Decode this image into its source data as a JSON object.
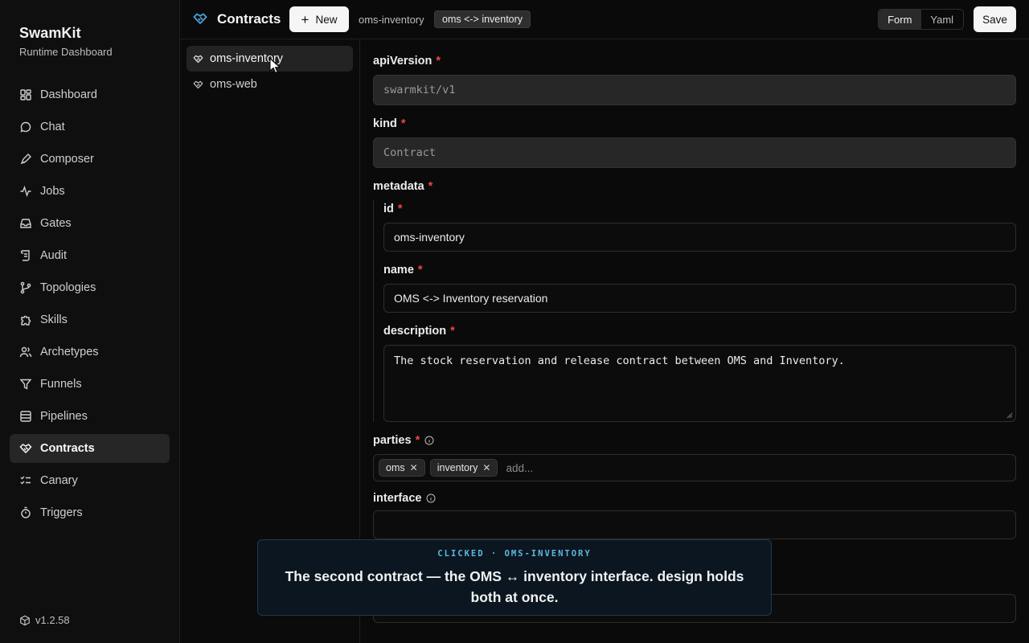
{
  "brand": {
    "name": "SwamKit",
    "subtitle": "Runtime Dashboard"
  },
  "nav": [
    {
      "label": "Dashboard",
      "icon": "dashboard-icon"
    },
    {
      "label": "Chat",
      "icon": "chat-icon"
    },
    {
      "label": "Composer",
      "icon": "composer-icon"
    },
    {
      "label": "Jobs",
      "icon": "activity-icon"
    },
    {
      "label": "Gates",
      "icon": "inbox-icon"
    },
    {
      "label": "Audit",
      "icon": "scroll-icon"
    },
    {
      "label": "Topologies",
      "icon": "branch-icon"
    },
    {
      "label": "Skills",
      "icon": "puzzle-icon"
    },
    {
      "label": "Archetypes",
      "icon": "users-icon"
    },
    {
      "label": "Funnels",
      "icon": "funnel-icon"
    },
    {
      "label": "Pipelines",
      "icon": "rows-icon"
    },
    {
      "label": "Contracts",
      "icon": "handshake-icon",
      "active": true
    },
    {
      "label": "Canary",
      "icon": "checklist-icon"
    },
    {
      "label": "Triggers",
      "icon": "timer-icon"
    }
  ],
  "version": "v1.2.58",
  "header": {
    "title": "Contracts",
    "new_label": "New",
    "breadcrumb": "oms-inventory",
    "breadcrumb_active": "oms <-> inventory",
    "view_form": "Form",
    "view_yaml": "Yaml",
    "save_label": "Save"
  },
  "contracts": [
    {
      "label": "oms-inventory",
      "active": true
    },
    {
      "label": "oms-web"
    }
  ],
  "form": {
    "apiVersion": {
      "label": "apiVersion",
      "value": "swarmkit/v1"
    },
    "kind": {
      "label": "kind",
      "value": "Contract"
    },
    "metadata": {
      "label": "metadata",
      "id": {
        "label": "id",
        "value": "oms-inventory"
      },
      "name": {
        "label": "name",
        "value": "OMS <-> Inventory reservation"
      },
      "description": {
        "label": "description",
        "value": "The stock reservation and release contract between OMS and Inventory."
      }
    },
    "parties": {
      "label": "parties",
      "tags": [
        "oms",
        "inventory"
      ],
      "add_placeholder": "add..."
    },
    "interface": {
      "label": "interface",
      "value": ""
    }
  },
  "toast": {
    "tag": "CLICKED · OMS-INVENTORY",
    "message": "The second contract — the OMS ↔ inventory interface. design holds both at once."
  },
  "colors": {
    "accent": "#5bb8e0",
    "required": "#ef4444",
    "logo": "#4aa3d8"
  }
}
